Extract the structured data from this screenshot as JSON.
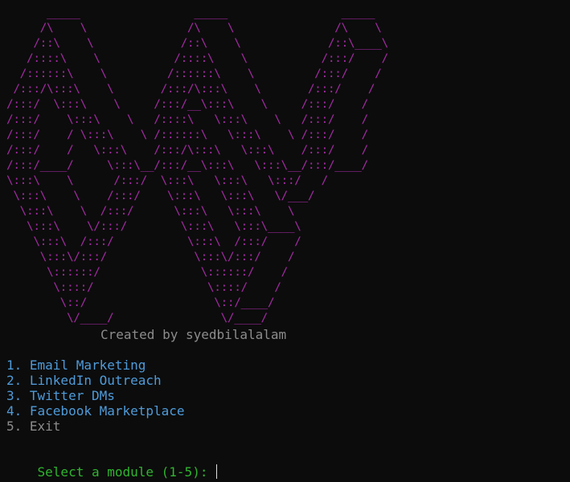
{
  "banner": {
    "art": "      _____                 _____                 _____\n     /\\    \\               /\\    \\               /\\    \\\n    /::\\    \\             /::\\    \\             /::\\____\\\n   /::::\\    \\           /::::\\    \\           /:::/    /\n  /::::::\\    \\         /::::::\\    \\         /:::/    /\n /:::/\\:::\\    \\       /:::/\\:::\\    \\       /:::/    /\n/:::/  \\:::\\    \\     /:::/__\\:::\\    \\     /:::/    /\n/:::/    \\:::\\    \\   /::::\\   \\:::\\    \\   /:::/    /\n/:::/    / \\:::\\    \\ /::::::\\   \\:::\\    \\ /:::/    /\n/:::/    /   \\:::\\    /:::/\\:::\\   \\:::\\    /:::/    /\n/:::/____/     \\:::\\__/:::/__\\:::\\   \\:::\\__/:::/____/\n\\:::\\    \\      /:::/  \\:::\\   \\:::\\   \\:::/   /\n \\:::\\    \\    /:::/    \\:::\\   \\:::\\   \\/___/\n  \\:::\\    \\  /:::/      \\:::\\   \\:::\\    \\\n   \\:::\\    \\/:::/        \\:::\\   \\:::\\____\\\n    \\:::\\  /:::/           \\:::\\  /:::/    /\n     \\:::\\/:::/             \\:::\\/:::/    /\n      \\::::::/               \\::::::/    /\n       \\::::/                 \\::::/    /\n        \\::/                   \\::/____/\n         \\/____/                \\/____/"
  },
  "credit": "Created by syedbilalalam",
  "menu": {
    "items": [
      {
        "label": "1. Email Marketing"
      },
      {
        "label": "2. LinkedIn Outreach"
      },
      {
        "label": "3. Twitter DMs"
      },
      {
        "label": "4. Facebook Marketplace"
      },
      {
        "label": "5. Exit"
      }
    ]
  },
  "prompt": {
    "text": "Select a module (1-5): "
  },
  "colors": {
    "background": "#0c0c0c",
    "banner": "#a32aa3",
    "credit": "#8c8c8c",
    "menu": "#4f9bd9",
    "exit": "#8c8c8c",
    "prompt": "#2fb52f"
  }
}
